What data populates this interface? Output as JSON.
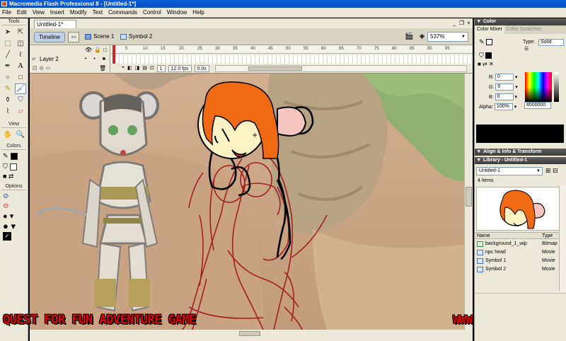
{
  "app": {
    "title": "Macromedia Flash Professional 8 - [Untitled-1*]"
  },
  "menu": [
    "File",
    "Edit",
    "View",
    "Insert",
    "Modify",
    "Text",
    "Commands",
    "Control",
    "Window",
    "Help"
  ],
  "tools": {
    "header": "Tools",
    "view_header": "View",
    "colors_header": "Colors",
    "options_header": "Options",
    "items": [
      "selection-tool",
      "subselection-tool",
      "free-transform-tool",
      "fill-transform-tool",
      "line-tool",
      "lasso-tool",
      "pen-tool",
      "text-tool",
      "oval-tool",
      "rectangle-tool",
      "pencil-tool",
      "brush-tool",
      "ink-bottle-tool",
      "paint-bucket-tool",
      "eyedropper-tool",
      "eraser-tool"
    ],
    "view_items": [
      "hand-tool",
      "zoom-tool"
    ],
    "stroke_color": "#000000",
    "fill_color": "#ffffff"
  },
  "document": {
    "tab": "Untitled-1*",
    "timeline_button": "Timeline",
    "breadcrumb": [
      "Scene 1",
      "Symbol 2"
    ],
    "zoom": "537%"
  },
  "timeline": {
    "layer_name": "Layer 2",
    "ruler_ticks": [
      "1",
      "5",
      "10",
      "15",
      "20",
      "25",
      "30",
      "35",
      "40",
      "45",
      "50",
      "55",
      "60",
      "65",
      "70",
      "75",
      "80",
      "85",
      "90",
      "95"
    ],
    "current_frame": "1",
    "frame_rate": "12.0 fps",
    "elapsed": "0.0s"
  },
  "captions": {
    "left": "QUEST FOR FUN ADVENTURE GAME",
    "right": "WWW.VIXINE.COM"
  },
  "color_panel": {
    "title": "Color",
    "tabs": [
      "Color Mixer",
      "Color Swatches"
    ],
    "type_label": "Type:",
    "type_value": "Solid",
    "r_label": "R:",
    "g_label": "G:",
    "b_label": "B:",
    "alpha_label": "Alpha:",
    "r": "0",
    "g": "0",
    "b": "0",
    "alpha": "100%",
    "hex": "#000000"
  },
  "align_panel": {
    "title": "Align & Info & Transform"
  },
  "library": {
    "title": "Library - Untitled-1",
    "selector": "Untitled-1",
    "count": "4 items",
    "col_name": "Name",
    "col_type": "Type",
    "items": [
      {
        "name": "background_1_wip",
        "type": "Bitmap"
      },
      {
        "name": "npc head",
        "type": "Movie"
      },
      {
        "name": "Symbol 1",
        "type": "Movie"
      },
      {
        "name": "Symbol 2",
        "type": "Movie"
      }
    ]
  }
}
